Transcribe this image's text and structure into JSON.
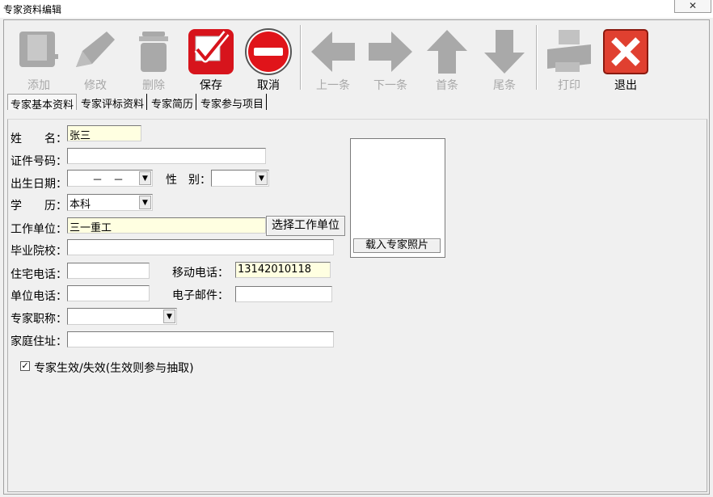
{
  "window": {
    "title": "专家资料编辑",
    "close_symbol": "✕"
  },
  "toolbar": {
    "add": "添加",
    "edit": "修改",
    "delete": "删除",
    "save": "保存",
    "cancel": "取消",
    "prev": "上一条",
    "next": "下一条",
    "first": "首条",
    "last": "尾条",
    "print": "打印",
    "exit": "退出"
  },
  "tabs": [
    "专家基本资料",
    "专家评标资料",
    "专家简历",
    "专家参与项目"
  ],
  "form": {
    "name_label": "姓　　名：",
    "name_value": "张三",
    "id_label": "证件号码：",
    "id_value": "",
    "birth_label": "出生日期：",
    "birth_value": "－　－",
    "gender_label": "性　别：",
    "gender_value": "",
    "edu_label": "学　　历：",
    "edu_value": "本科",
    "workplace_label": "工作单位：",
    "workplace_value": "三一重工",
    "select_workplace_button": "选择工作单位",
    "school_label": "毕业院校：",
    "school_value": "",
    "home_phone_label": "住宅电话：",
    "home_phone_value": "",
    "mobile_label": "移动电话：",
    "mobile_value": "13142010118",
    "work_phone_label": "单位电话：",
    "work_phone_value": "",
    "email_label": "电子邮件：",
    "email_value": "",
    "title_label": "专家职称：",
    "title_value": "",
    "address_label": "家庭住址：",
    "address_value": "",
    "load_photo_button": "载入专家照片",
    "active_checkbox_label": "专家生效/失效(生效则参与抽取)",
    "active_checked": true,
    "check_mark": "✓",
    "dropdown_arrow": "▼"
  },
  "colors": {
    "save_red": "#d7141c",
    "cancel_red": "#e0141a",
    "disabled_gray": "#a9a9a9",
    "input_yellow": "#ffffe1"
  }
}
